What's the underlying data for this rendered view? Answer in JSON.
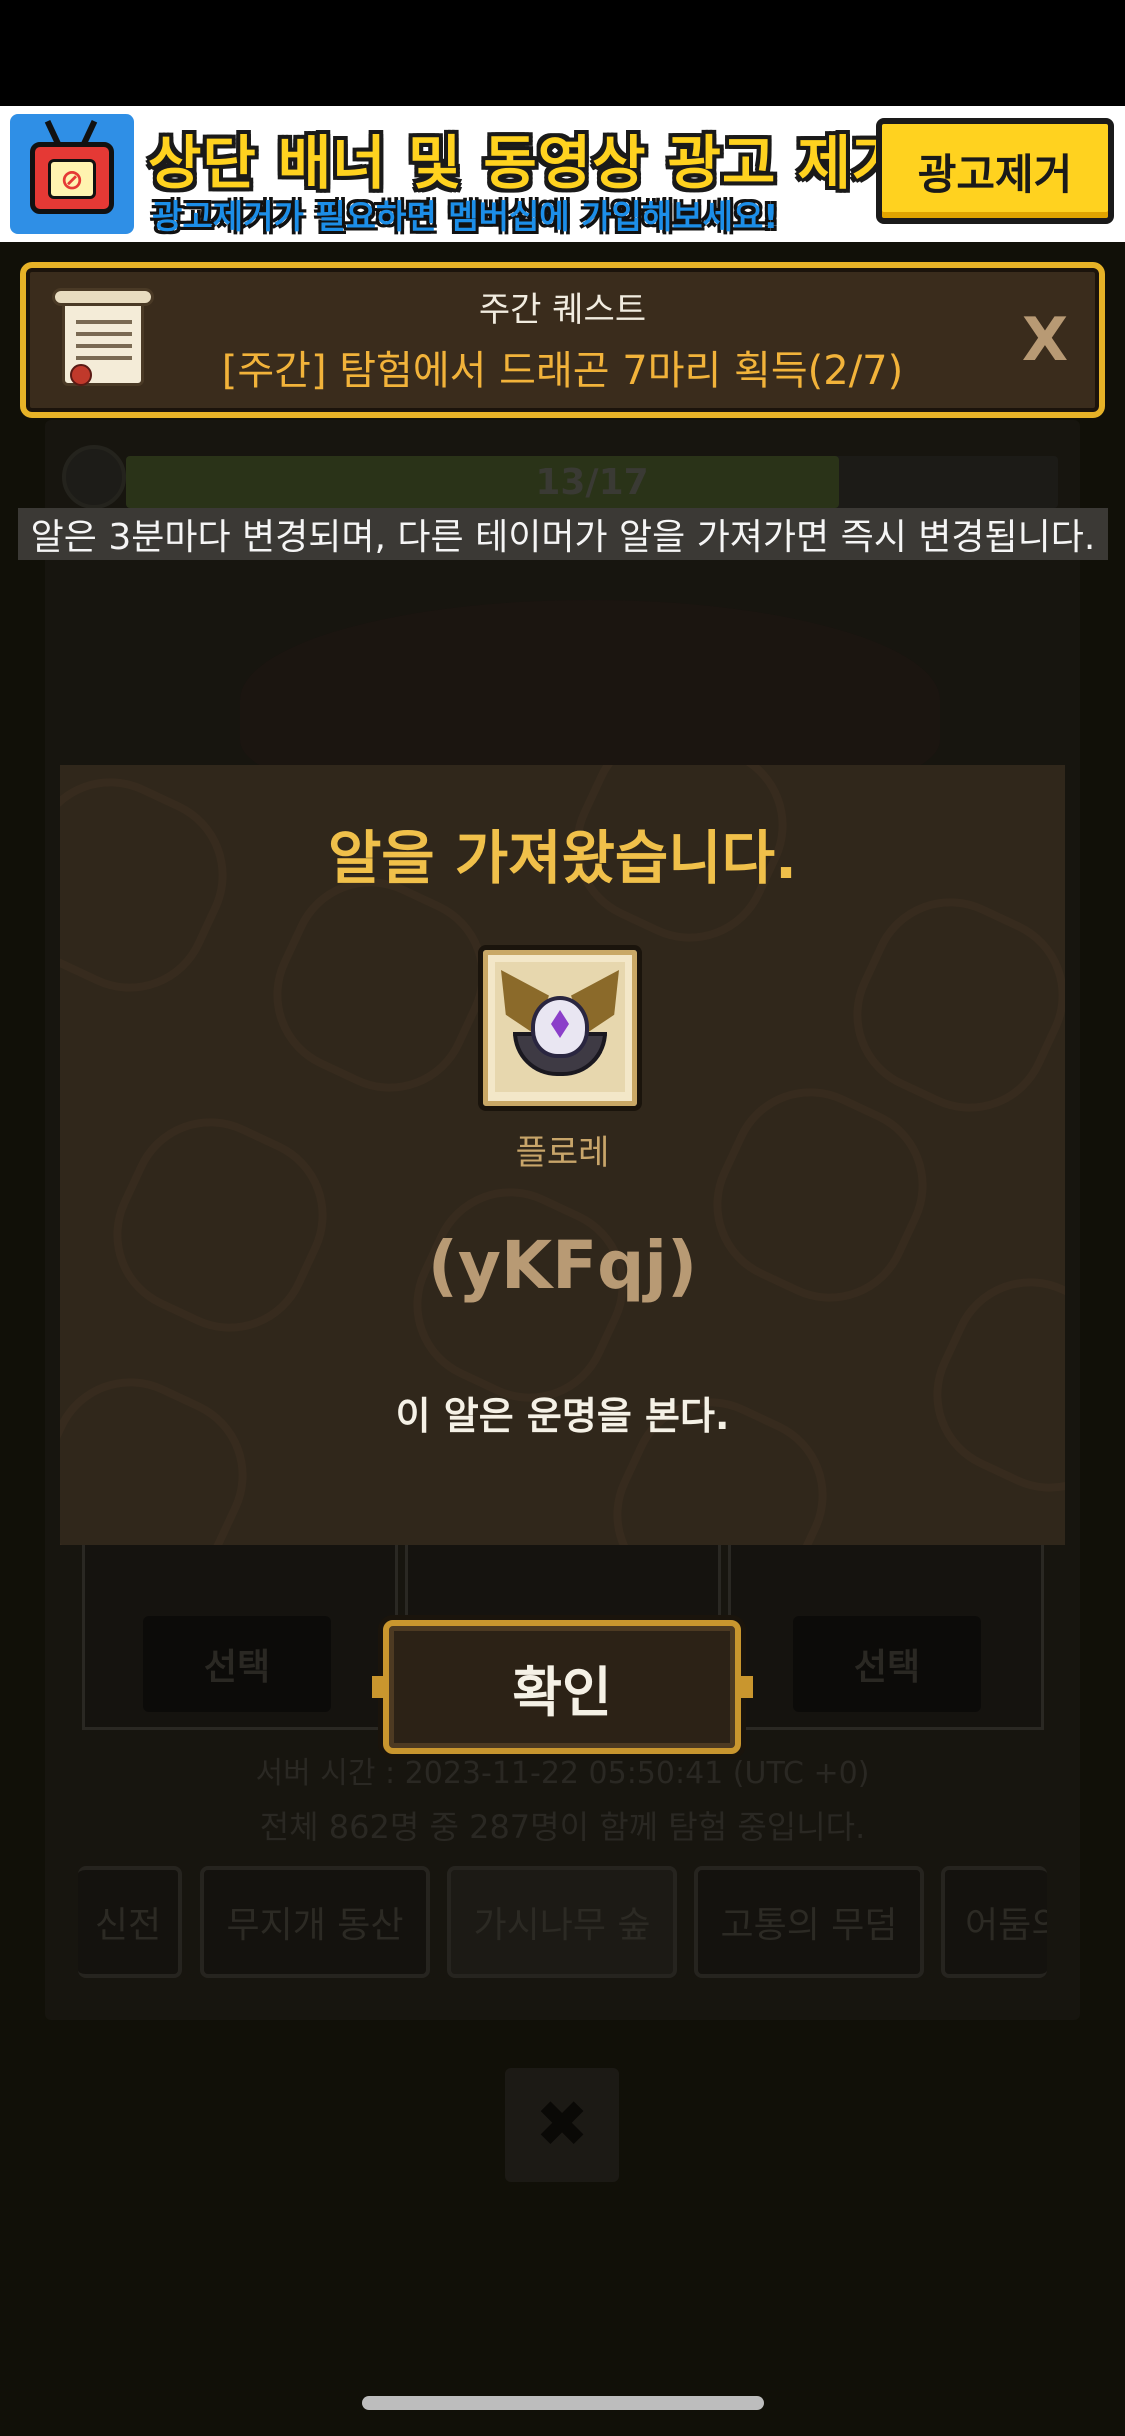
{
  "ad_banner": {
    "headline": "상단 배너 및 동영상 광고 제거!",
    "subtext": "광고제거가 필요하면 멤버십에 가입해보세요!",
    "button_label": "광고제거",
    "icon": "tv-no-ads-icon"
  },
  "quest": {
    "title": "주간 퀘스트",
    "description": "[주간] 탐험에서 드래곤 7마리 획득(2/7)",
    "close_label": "X",
    "icon": "scroll-icon"
  },
  "background": {
    "progress_label": "13/17",
    "progress_fraction": 0.7647,
    "select_label_left": "선택",
    "select_label_right": "선택",
    "server_time": "서버 시간 : 2023-11-22 05:50:41 (UTC +0)",
    "player_count": "전체 862명 중 287명이 함께 탐험 중입니다.",
    "area_tabs": [
      "신전",
      "무지개 동산",
      "가시나무 숲",
      "고통의 무덤",
      "어둠의"
    ],
    "close_icon_label": "✖"
  },
  "notice": "알은 3분마다 변경되며, 다른 테이머가 알을 가져가면 즉시 변경됩니다.",
  "modal": {
    "title": "알을 가져왔습니다.",
    "egg_name": "플로레",
    "egg_code": "(yKFqj)",
    "egg_description": "이 알은 운명을 본다.",
    "egg_icon": "egg-icon"
  },
  "confirm_label": "확인",
  "colors": {
    "accent_gold": "#f0c04a",
    "quest_orange": "#f2b33a",
    "frame_gold": "#e6b227",
    "modal_bg": "#30271b"
  }
}
